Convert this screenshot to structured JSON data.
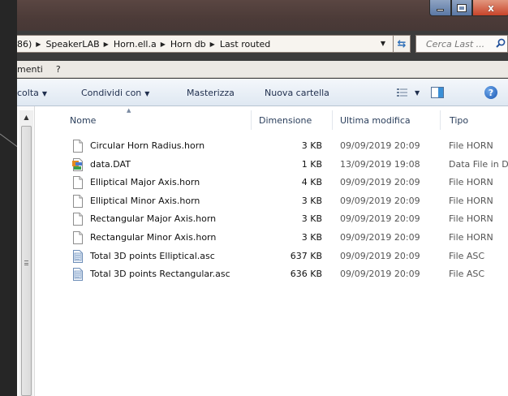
{
  "window": {
    "controls": {
      "minimize": "minimize",
      "maximize": "maximize",
      "close": "x"
    }
  },
  "address": {
    "crumbs": [
      "86)",
      "SpeakerLAB",
      "Horn.ell.a",
      "Horn db",
      "Last routed"
    ],
    "search_placeholder": "Cerca Last ..."
  },
  "menubar": {
    "items": [
      "menti",
      "?"
    ]
  },
  "cmdbar": {
    "organize": "colta",
    "share": "Condividi con",
    "burn": "Masterizza",
    "new_folder": "Nuova cartella"
  },
  "columns": {
    "name": "Nome",
    "size": "Dimensione",
    "modified": "Ultima modifica",
    "type": "Tipo"
  },
  "files": [
    {
      "name": "Circular Horn Radius.horn",
      "size": "3 KB",
      "modified": "09/09/2019 20:09",
      "type": "File HORN",
      "icon": "blank-file-icon"
    },
    {
      "name": "data.DAT",
      "size": "1 KB",
      "modified": "13/09/2019 19:08",
      "type": "Data File in DAT",
      "icon": "data-file-icon"
    },
    {
      "name": "Elliptical Major Axis.horn",
      "size": "4 KB",
      "modified": "09/09/2019 20:09",
      "type": "File HORN",
      "icon": "blank-file-icon"
    },
    {
      "name": "Elliptical Minor Axis.horn",
      "size": "3 KB",
      "modified": "09/09/2019 20:09",
      "type": "File HORN",
      "icon": "blank-file-icon"
    },
    {
      "name": "Rectangular Major Axis.horn",
      "size": "3 KB",
      "modified": "09/09/2019 20:09",
      "type": "File HORN",
      "icon": "blank-file-icon"
    },
    {
      "name": "Rectangular Minor Axis.horn",
      "size": "3 KB",
      "modified": "09/09/2019 20:09",
      "type": "File HORN",
      "icon": "blank-file-icon"
    },
    {
      "name": "Total 3D points Elliptical.asc",
      "size": "637 KB",
      "modified": "09/09/2019 20:09",
      "type": "File ASC",
      "icon": "text-file-icon"
    },
    {
      "name": "Total 3D points Rectangular.asc",
      "size": "636 KB",
      "modified": "09/09/2019 20:09",
      "type": "File ASC",
      "icon": "text-file-icon"
    }
  ]
}
